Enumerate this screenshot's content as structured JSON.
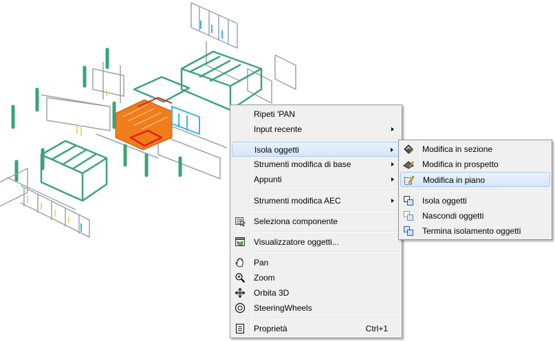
{
  "context_menu": {
    "items": [
      {
        "label": "Ripeti 'PAN"
      },
      {
        "label": "Input recente",
        "submenu": true
      },
      {
        "label": "Isola oggetti",
        "submenu": true,
        "highlighted": true
      },
      {
        "label": "Strumenti modifica di base",
        "submenu": true
      },
      {
        "label": "Appunti",
        "submenu": true
      },
      {
        "label": "Strumenti modifica AEC",
        "submenu": true
      },
      {
        "label": "Seleziona componente",
        "icon": "select-component-icon"
      },
      {
        "label": "Visualizzatore oggetti...",
        "icon": "object-viewer-icon"
      },
      {
        "label": "Pan",
        "icon": "hand-pan-icon"
      },
      {
        "label": "Zoom",
        "icon": "zoom-icon"
      },
      {
        "label": "Orbita 3D",
        "icon": "orbit-3d-icon"
      },
      {
        "label": "SteeringWheels",
        "icon": "steering-wheel-icon"
      },
      {
        "label": "Proprietà",
        "icon": "properties-icon",
        "shortcut": "Ctrl+1"
      }
    ]
  },
  "submenu": {
    "items": [
      {
        "label": "Modifica in sezione",
        "icon": "edit-in-section-icon"
      },
      {
        "label": "Modifica in prospetto",
        "icon": "edit-in-elevation-icon"
      },
      {
        "label": "Modifica in piano",
        "icon": "edit-in-plan-icon",
        "highlighted": true
      },
      {
        "label": "Isola oggetti",
        "icon": "isolate-objects-icon"
      },
      {
        "label": "Nascondi oggetti",
        "icon": "hide-objects-icon"
      },
      {
        "label": "Termina isolamento oggetti",
        "icon": "end-isolation-icon"
      }
    ]
  },
  "colors": {
    "walls": "#9aa3aa",
    "frames": "#3aa37a",
    "highlight_orange": "#f07d1a",
    "highlight_red": "#e02020",
    "glass_blue": "#37b6e6",
    "door_yellow": "#e8d86a"
  }
}
